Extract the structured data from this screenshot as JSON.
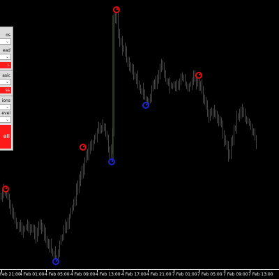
{
  "chart": {
    "background": "#000000",
    "candle_color": "#2d5a1b",
    "up_marker_color": "#e01010",
    "down_marker_color": "#1a28d0",
    "axis_color": "#ffffff"
  },
  "panel": {
    "row1_label": "os",
    "row2_label": "ead",
    "row3_button": "L",
    "row4_label": "asic",
    "row5_button": "ss",
    "row6_label": "ions",
    "row7_label": "evel",
    "big_button": "ell",
    "dropdown_arrow": "⌄",
    "button_color": "#ff1a1a",
    "panel_color": "#dcdcdc"
  },
  "time_axis": {
    "labels": [
      "Feb 21:00",
      "4 Feb 01:00",
      "4 Feb 05:00",
      "4 Feb 09:00",
      "4 Feb 13:00",
      "4 Feb 17:00",
      "4 Feb 21:00",
      "7 Feb 01:00",
      "7 Feb 05:00",
      "7 Feb 09:00",
      "7 Feb 13:00"
    ]
  },
  "markers": [
    {
      "type": "up",
      "label": "red-circle-marker"
    },
    {
      "type": "up",
      "label": "red-circle-marker"
    },
    {
      "type": "up",
      "label": "red-circle-marker"
    },
    {
      "type": "up",
      "label": "red-circle-marker"
    },
    {
      "type": "down",
      "label": "blue-circle-marker"
    },
    {
      "type": "down",
      "label": "blue-circle-marker"
    },
    {
      "type": "down",
      "label": "blue-circle-marker"
    }
  ]
}
